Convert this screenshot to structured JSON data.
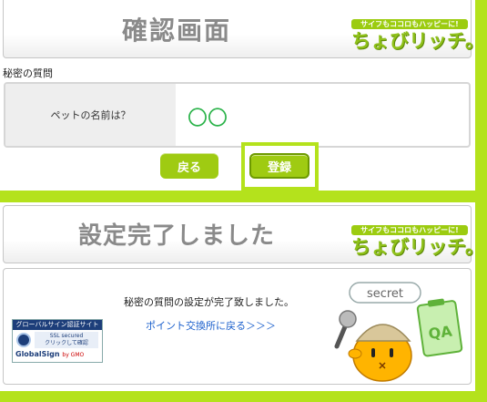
{
  "confirm": {
    "title": "確認画面",
    "logo_tagline": "サイフもココロもハッピーに!",
    "logo_name": "ちょびリッチ。",
    "section_label": "秘密の質問",
    "question": "ペットの名前は？",
    "answer": "〇〇",
    "back_button": "戻る",
    "register_button": "登録"
  },
  "complete": {
    "title": "設定完了しました",
    "logo_tagline": "サイフもココロもハッピーに!",
    "logo_name": "ちょびリッチ。",
    "message": "秘密の質問の設定が完了致しました。",
    "link": "ポイント交換所に戻る＞＞＞",
    "badge": {
      "header": "グローバルサイン認証サイト",
      "ssl_line1": "SSL secured",
      "ssl_line2": "クリックして確認",
      "brand": "GlobalSign",
      "by": "by GMO"
    },
    "mascot_bubble": "secret",
    "mascot_board": "QA"
  },
  "colors": {
    "page_green": "#b4e21c",
    "button_green": "#9fcb12",
    "answer_green": "#2bb34a",
    "link_blue": "#1a5fcc"
  }
}
